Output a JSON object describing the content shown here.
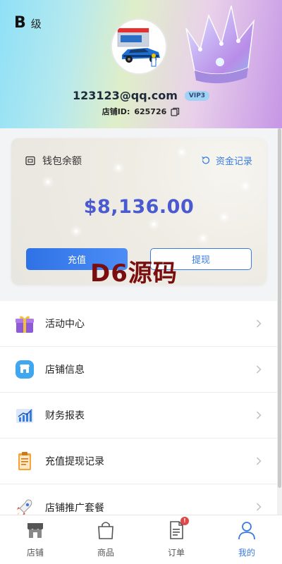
{
  "profile": {
    "level_letter": "B",
    "level_text": "级",
    "email": "123123@qq.com",
    "vip": "VIP3",
    "shop_id_label": "店铺ID:",
    "shop_id": "625726"
  },
  "wallet": {
    "title": "钱包余额",
    "records": "资金记录",
    "balance": "$8,136.00",
    "recharge": "充值",
    "withdraw": "提现"
  },
  "watermark": "D6源码",
  "menu": [
    {
      "label": "活动中心",
      "icon": "gift-icon"
    },
    {
      "label": "店铺信息",
      "icon": "shop-info-icon"
    },
    {
      "label": "财务报表",
      "icon": "finance-chart-icon"
    },
    {
      "label": "充值提现记录",
      "icon": "clipboard-icon"
    },
    {
      "label": "店铺推广套餐",
      "icon": "rocket-icon"
    }
  ],
  "nav": [
    {
      "label": "店铺",
      "icon": "store-icon"
    },
    {
      "label": "商品",
      "icon": "shopping-bag-icon"
    },
    {
      "label": "订单",
      "icon": "order-doc-icon",
      "badge": "!"
    },
    {
      "label": "我的",
      "icon": "user-icon",
      "active": true
    }
  ],
  "colors": {
    "accent": "#3a7be0",
    "balance": "#4a5ad0",
    "badge": "#e04848"
  }
}
